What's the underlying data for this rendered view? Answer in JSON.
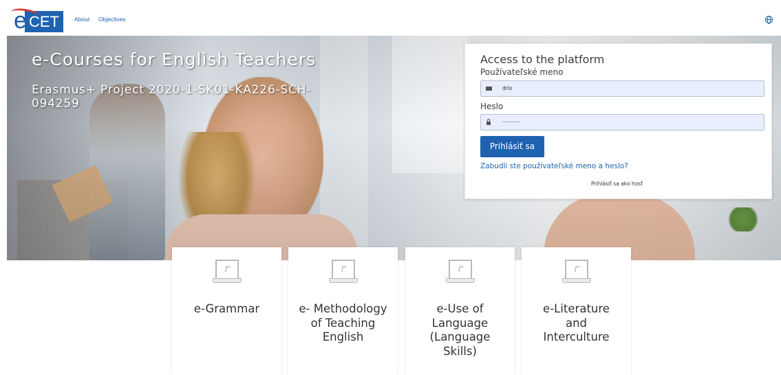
{
  "brand": {
    "logo_e": "e",
    "logo_cet": "CET"
  },
  "nav": {
    "links": [
      "About",
      "Objectives"
    ],
    "language_icon": "globe-icon"
  },
  "hero": {
    "title": "e-Courses for English Teachers",
    "subtitle": "Erasmus+ Project 2020-1-SK01-KA226-SCH-094259"
  },
  "login": {
    "title": "Access to the platform",
    "username_label": "Používateľské meno",
    "username_value": "drlo",
    "username_icon": "envelope-icon",
    "password_label": "Heslo",
    "password_value": "...........",
    "password_icon": "lock-icon",
    "submit_label": "Prihlásiť sa",
    "forgot_link": "Zabudli ste používateľské meno a heslo?",
    "guest_link": "Prihlásiť sa ako hosť"
  },
  "courses": [
    {
      "title": "e-Grammar",
      "icon": "laptop-icon"
    },
    {
      "title": "e- Methodology of Teaching English",
      "icon": "laptop-icon"
    },
    {
      "title": "e-Use of Language (Language Skills)",
      "icon": "laptop-icon"
    },
    {
      "title": "e-Literature and Interculture",
      "icon": "laptop-icon"
    }
  ],
  "colors": {
    "brand_blue": "#1f63b0",
    "logo_red": "#d83a2a",
    "input_bg": "#e8eefc"
  }
}
